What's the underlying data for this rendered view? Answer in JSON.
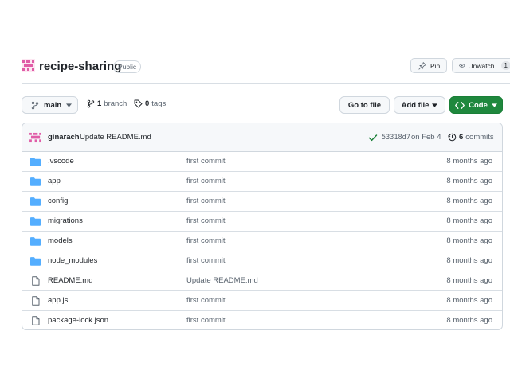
{
  "repo": {
    "name": "recipe-sharing",
    "visibility": "Public"
  },
  "actions": {
    "pin_label": "Pin",
    "unwatch_label": "Unwatch",
    "watch_count": "1"
  },
  "toolbar": {
    "branch": "main",
    "branch_count": "1",
    "branch_word": "branch",
    "tag_count": "0",
    "tag_word": "tags",
    "goto_file": "Go to file",
    "add_file": "Add file",
    "code": "Code"
  },
  "latest_commit": {
    "author": "ginarach",
    "message": "Update README.md",
    "hash": "53318d7",
    "date": "on Feb 4",
    "count": "6",
    "count_word": "commits"
  },
  "files": [
    {
      "type": "folder",
      "name": ".vscode",
      "message": "first commit",
      "age": "8 months ago"
    },
    {
      "type": "folder",
      "name": "app",
      "message": "first commit",
      "age": "8 months ago"
    },
    {
      "type": "folder",
      "name": "config",
      "message": "first commit",
      "age": "8 months ago"
    },
    {
      "type": "folder",
      "name": "migrations",
      "message": "first commit",
      "age": "8 months ago"
    },
    {
      "type": "folder",
      "name": "models",
      "message": "first commit",
      "age": "8 months ago"
    },
    {
      "type": "folder",
      "name": "node_modules",
      "message": "first commit",
      "age": "8 months ago"
    },
    {
      "type": "file",
      "name": "README.md",
      "message": "Update README.md",
      "age": "8 months ago"
    },
    {
      "type": "file",
      "name": "app.js",
      "message": "first commit",
      "age": "8 months ago"
    },
    {
      "type": "file",
      "name": "package-lock.json",
      "message": "first commit",
      "age": "8 months ago"
    }
  ],
  "colors": {
    "folder": "#54aeff",
    "code_button": "#1f883d",
    "avatar": "#e05ca7",
    "check": "#1a7f37"
  }
}
